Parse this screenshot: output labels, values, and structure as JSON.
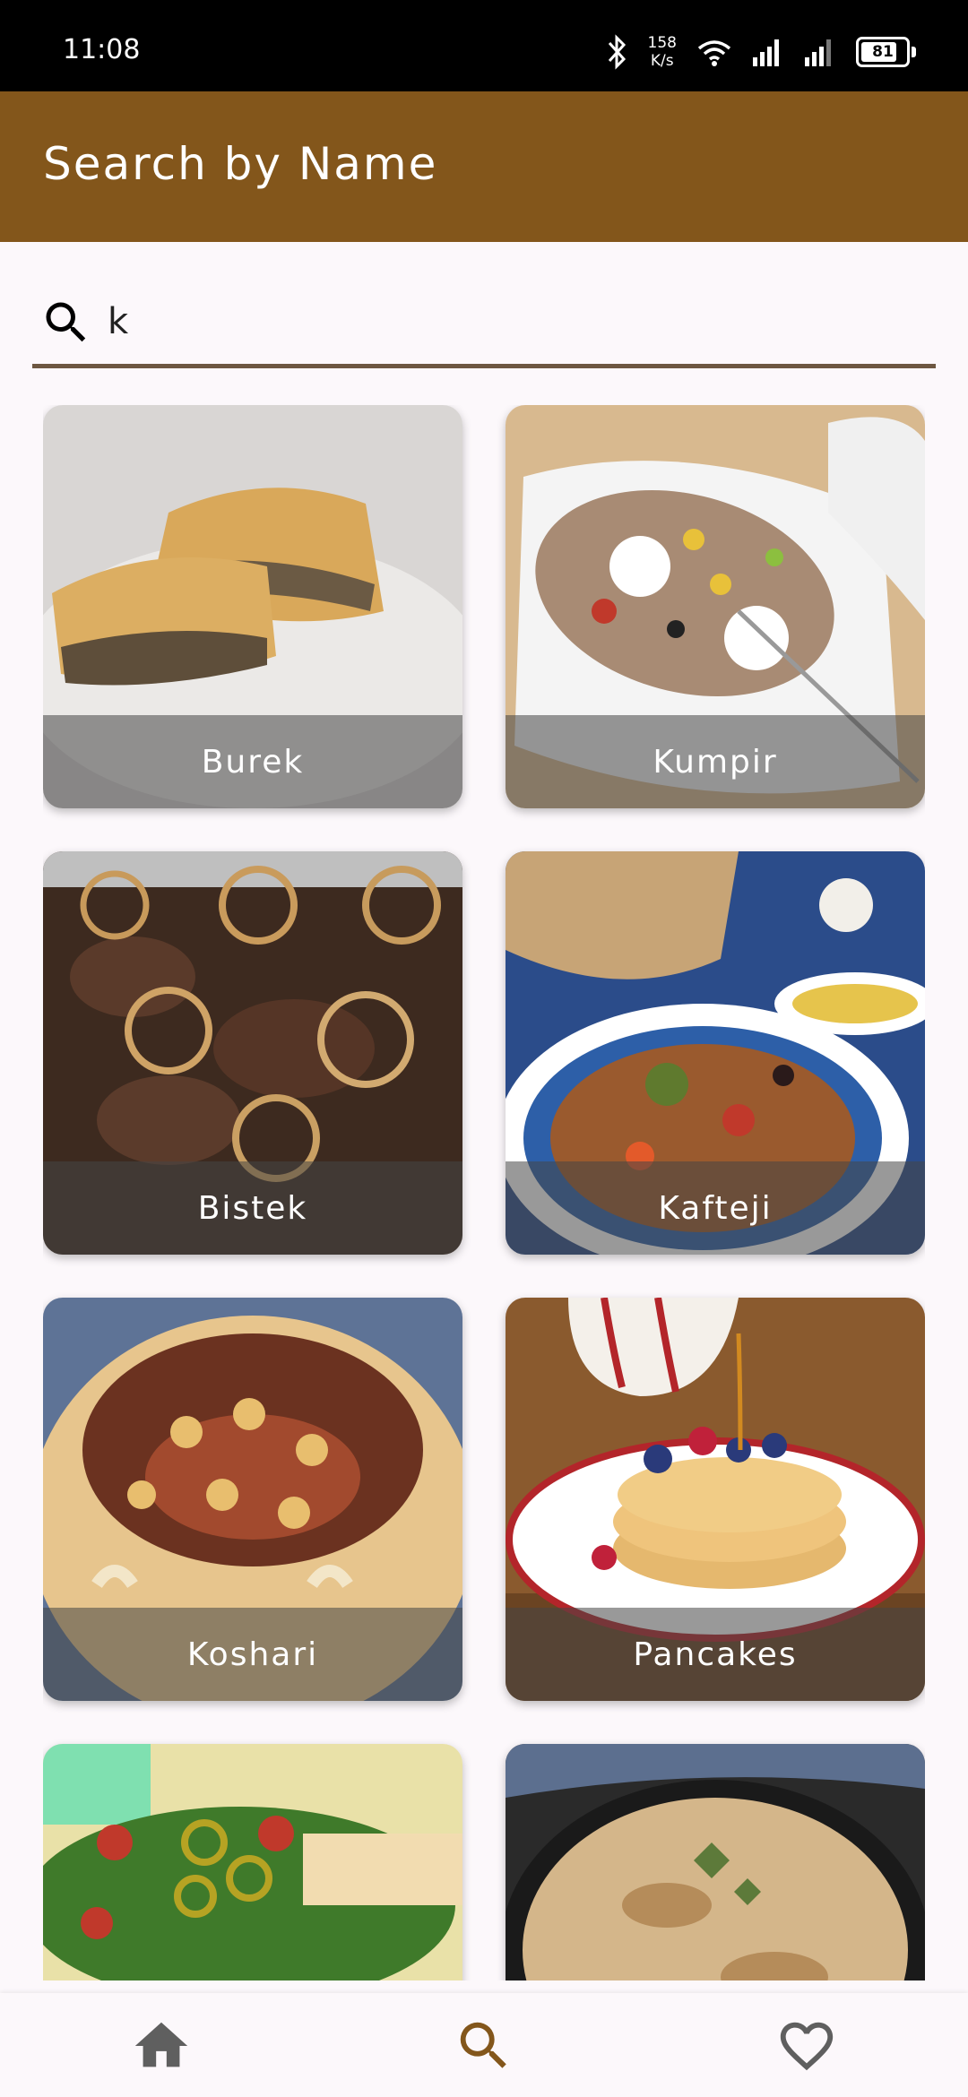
{
  "status_bar": {
    "time": "11:08",
    "net_speed_value": "158",
    "net_speed_unit": "K/s",
    "battery": "81",
    "battery_level": 0.81
  },
  "app_bar": {
    "title": "Search by Name"
  },
  "search": {
    "value": "k",
    "icon": "search-icon"
  },
  "meals": [
    {
      "name": "Burek"
    },
    {
      "name": "Kumpir"
    },
    {
      "name": "Bistek"
    },
    {
      "name": "Kafteji"
    },
    {
      "name": "Koshari"
    },
    {
      "name": "Pancakes"
    },
    {
      "name": ""
    },
    {
      "name": ""
    }
  ],
  "bottom_nav": {
    "items": [
      {
        "icon": "home-icon",
        "active": false
      },
      {
        "icon": "search-icon",
        "active": true
      },
      {
        "icon": "heart-icon",
        "active": false
      }
    ],
    "active_color": "#83561b",
    "inactive_color": "#5f5f5f"
  },
  "colors": {
    "primary": "#83561b",
    "background": "#fcf8fb",
    "underline": "#6d5741"
  }
}
